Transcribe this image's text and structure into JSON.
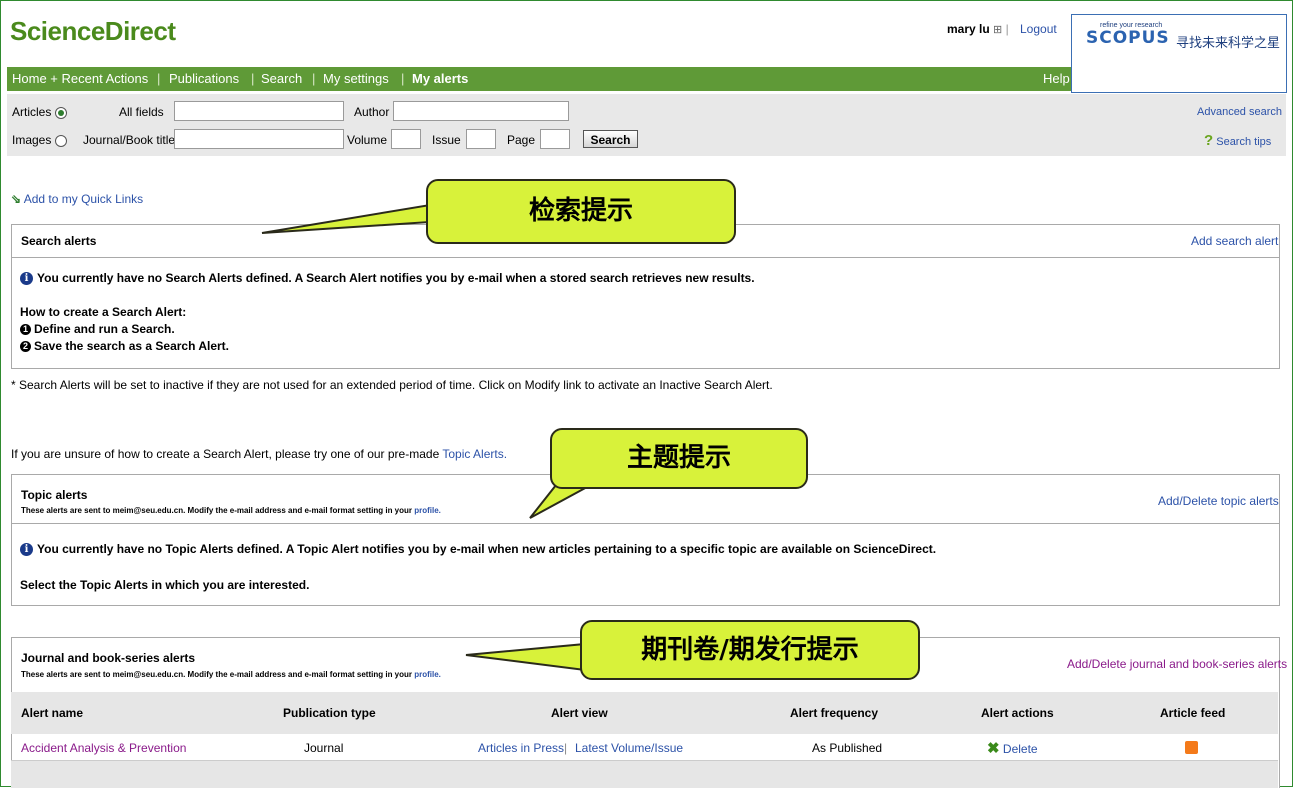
{
  "header": {
    "logo": "ScienceDirect",
    "user": "mary lu",
    "logout": "Logout"
  },
  "scopus": {
    "tagline": "refine your research",
    "brand": "SCOPUS",
    "slogan": "寻找未来科学之星"
  },
  "nav": {
    "items": [
      "Home + Recent Actions",
      "Publications",
      "Search",
      "My settings",
      "My alerts"
    ],
    "help": "Help"
  },
  "search": {
    "articles_label": "Articles",
    "images_label": "Images",
    "all_fields": "All fields",
    "author": "Author",
    "journal_title": "Journal/Book title",
    "volume": "Volume",
    "issue": "Issue",
    "page": "Page",
    "button": "Search",
    "advanced": "Advanced search",
    "tips": "Search tips"
  },
  "quick_links": "Add to my Quick Links",
  "search_alerts": {
    "title": "Search alerts",
    "add": "Add search alert",
    "info": "You currently have no Search Alerts defined. A Search Alert notifies you by e-mail when a stored search retrieves new results.",
    "how": "How to create a Search Alert:",
    "step1": "Define and run a Search.",
    "step2": "Save the search as a Search Alert."
  },
  "note": "* Search Alerts will be set to inactive if they are not used for an extended period of time. Click on Modify link to activate an Inactive Search Alert.",
  "unsure": {
    "text": "If you are unsure of how to create a Search Alert, please try one of our pre-made ",
    "link": "Topic Alerts."
  },
  "topic_alerts": {
    "title": "Topic alerts",
    "sub": "These alerts are sent to meim@seu.edu.cn. Modify the e-mail address and e-mail format setting in your ",
    "profile": "profile.",
    "add": "Add/Delete topic alerts",
    "info": "You currently have no Topic Alerts defined. A Topic Alert notifies you by e-mail when new articles pertaining to a specific topic are available on ScienceDirect.",
    "select": "Select the Topic Alerts in which you are interested."
  },
  "journal_alerts": {
    "title": "Journal and book-series alerts",
    "sub": "These alerts are sent to meim@seu.edu.cn. Modify the e-mail address and e-mail format setting in your ",
    "profile": "profile.",
    "add": "Add/Delete journal and book-series alerts"
  },
  "table": {
    "headers": [
      "Alert name",
      "Publication type",
      "Alert view",
      "Alert frequency",
      "Alert actions",
      "Article feed"
    ],
    "row": {
      "name": "Accident Analysis & Prevention",
      "type": "Journal",
      "view1": "Articles in Press",
      "view2": "Latest Volume/Issue",
      "frequency": "As Published",
      "action": "Delete"
    }
  },
  "callouts": {
    "search": "检索提示",
    "topic": "主题提示",
    "journal": "期刊卷/期发行提示"
  },
  "colors": {
    "brand_green": "#4a8a1c",
    "nav_green": "#5f9a37",
    "callout_yellow": "#d8f23a",
    "link_blue": "#2c52a8",
    "visited_purple": "#8a1a8a"
  }
}
